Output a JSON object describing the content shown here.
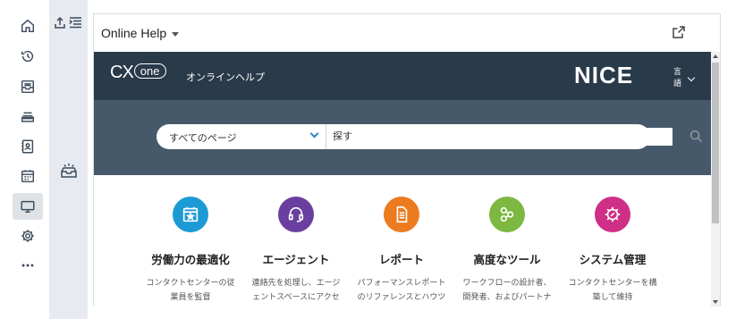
{
  "rail": {
    "items": [
      {
        "icon": "home-icon",
        "active": false
      },
      {
        "icon": "history-icon",
        "active": false
      },
      {
        "icon": "inbox-icon",
        "active": false
      },
      {
        "icon": "list-icon",
        "active": false
      },
      {
        "icon": "contacts-icon",
        "active": false
      },
      {
        "icon": "calendar-icon",
        "active": false
      },
      {
        "icon": "monitor-icon",
        "active": true
      },
      {
        "icon": "gear-icon",
        "active": false
      },
      {
        "icon": "more-icon",
        "active": false
      }
    ]
  },
  "card": {
    "title": "Online Help"
  },
  "help": {
    "logo_text": "CX",
    "logo_badge": "one",
    "banner_title": "オンラインヘルプ",
    "brand": "NICE",
    "language_label": "言語",
    "search": {
      "scope": "すべてのページ",
      "placeholder": "探す"
    },
    "tiles": [
      {
        "title": "労働力の最適化",
        "desc1": "コンタクトセンターの従",
        "desc2": "業員を監督",
        "color": "#1b9ad6",
        "icon": "calendar-star-icon"
      },
      {
        "title": "エージェント",
        "desc1": "連絡先を処理し、エージ",
        "desc2": "ェントスペースにアクセ",
        "color": "#6a3fa0",
        "icon": "headset-icon"
      },
      {
        "title": "レポート",
        "desc1": "パフォーマンスレポート",
        "desc2": "のリファレンスとハウツ",
        "color": "#ec7a1f",
        "icon": "document-icon"
      },
      {
        "title": "高度なツール",
        "desc1": "ワークフローの設計者、",
        "desc2": "開発者、およびパートナ",
        "color": "#7cb842",
        "icon": "workflow-icon"
      },
      {
        "title": "システム管理",
        "desc1": "コンタクトセンターを構",
        "desc2": "築して維持",
        "color": "#cf2f86",
        "icon": "gear-wrench-icon"
      }
    ]
  }
}
